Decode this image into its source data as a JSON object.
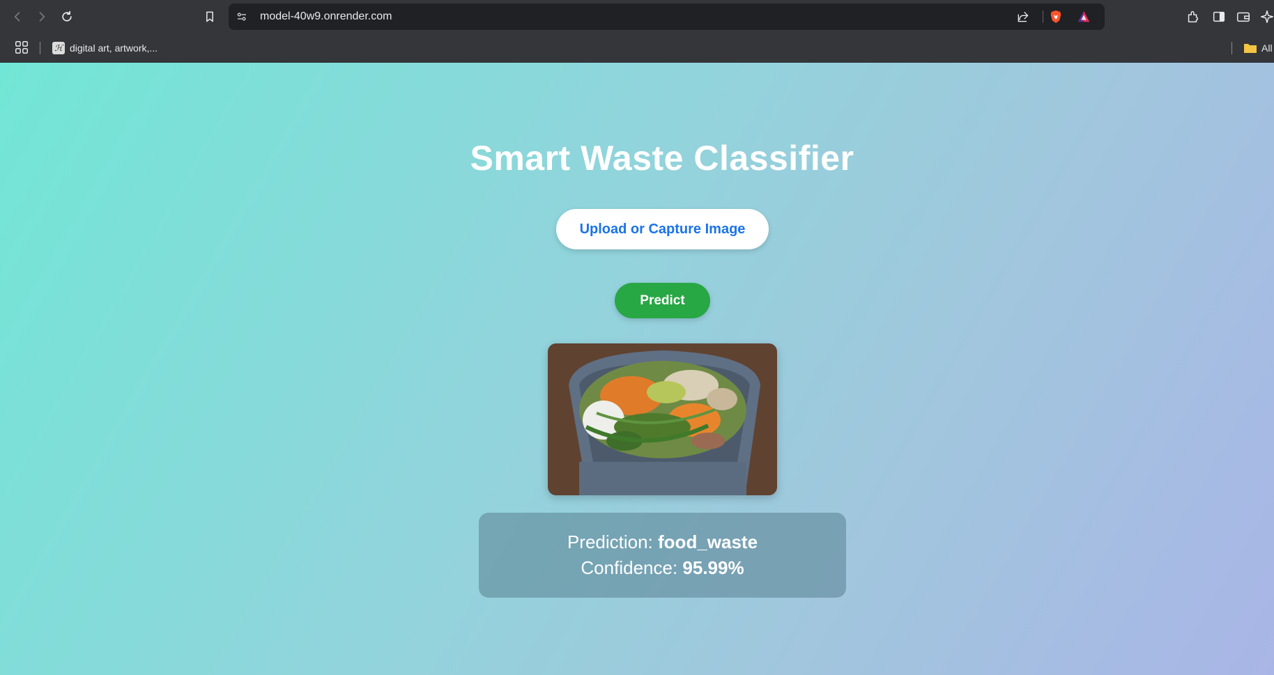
{
  "browser": {
    "url": "model-40w9.onrender.com",
    "bookmarks": [
      {
        "label": "digital art, artwork,..."
      }
    ],
    "bookmarks_all_label": "All"
  },
  "app": {
    "title": "Smart Waste Classifier",
    "upload_label": "Upload or Capture Image",
    "predict_label": "Predict",
    "result": {
      "prediction_label": "Prediction:",
      "prediction_value": "food_waste",
      "confidence_label": "Confidence:",
      "confidence_value": "95.99%"
    }
  },
  "colors": {
    "upload_text": "#1a73e8",
    "predict_bg": "#28a745",
    "gradient_start": "#72e6d6",
    "gradient_end": "#a9b5e6"
  }
}
